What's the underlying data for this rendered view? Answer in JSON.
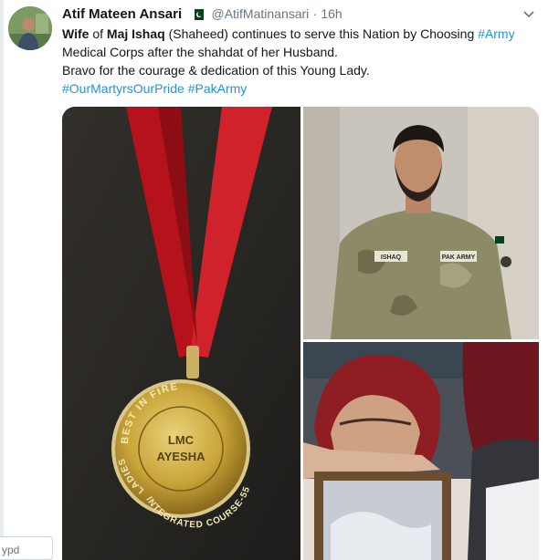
{
  "tweet": {
    "author_name": "Atif Mateen Ansari",
    "handle": "@AtifMatinansari",
    "separator": "·",
    "time": "16h",
    "line1": {
      "w1": "Wife",
      "t1": " of ",
      "w2": "Maj Ishaq",
      "t2": " (Shaheed) continues to serve this Nation by Choosing ",
      "tag": "#Army"
    },
    "line2": "Medical Corps after the shahdat of her Husband.",
    "line3": "Bravo for the courage & dedication of this Young Lady.",
    "hashtags": [
      "#OurMartyrsOurPride",
      "#PakArmy"
    ]
  },
  "medal": {
    "ring_top": "BEST IN FIRE",
    "ring_left": "LADIES",
    "ring_bottom": "INTEGRATED COURSE-55",
    "center_line1": "LMC",
    "center_line2": "AYESHA"
  },
  "uniform": {
    "name_tape": "ISHAQ",
    "army_tape": "PAK ARMY"
  },
  "reply_box": {
    "text": "ypd"
  },
  "icons": [
    "flag-icon",
    "chevron-down-icon"
  ],
  "colors": {
    "link": "#1b95e0",
    "muted": "#657786",
    "ribbon": "#c8102e"
  }
}
